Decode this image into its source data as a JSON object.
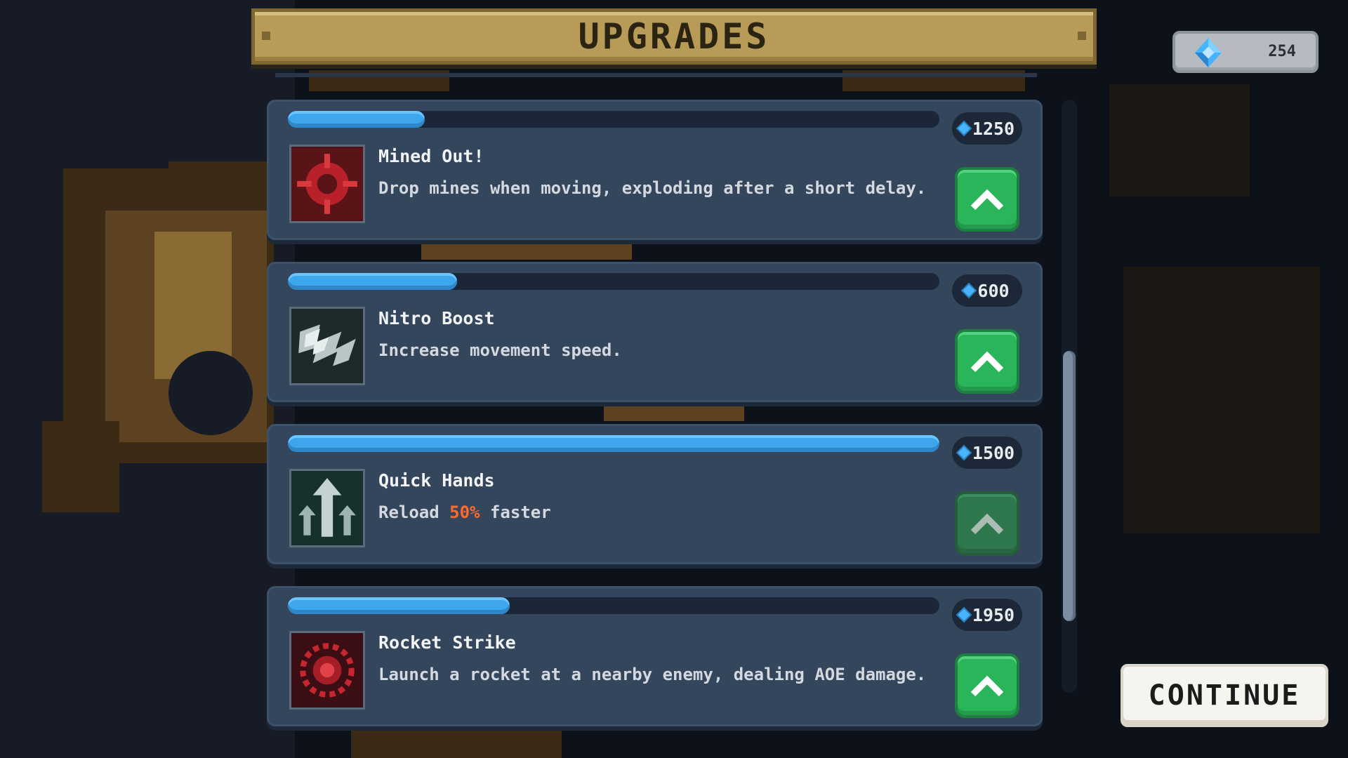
{
  "header": {
    "title": "UPGRADES"
  },
  "currency": {
    "gems": "254",
    "icon": "diamond-gem-icon",
    "color": "#48b4ff"
  },
  "upgrades": [
    {
      "name": "Mined Out!",
      "description": "Drop mines when moving, exploding after a short delay.",
      "cost": "1250",
      "progress": 0.21,
      "icon": "mine-icon",
      "can_afford": true
    },
    {
      "name": "Nitro Boost",
      "description": "Increase movement speed.",
      "cost": "600",
      "progress": 0.26,
      "icon": "lightning-icon",
      "can_afford": true
    },
    {
      "name": "Quick Hands",
      "description_before": "Reload ",
      "description_highlight": "50%",
      "description_after": " faster",
      "cost": "1500",
      "progress": 1.0,
      "icon": "arrows-up-icon",
      "can_afford": false
    },
    {
      "name": "Rocket Strike",
      "description": "Launch a rocket at a nearby enemy, dealing AOE damage.",
      "cost": "1950",
      "progress": 0.34,
      "icon": "target-icon",
      "can_afford": true
    }
  ],
  "actions": {
    "continue_label": "CONTINUE"
  },
  "colors": {
    "progress": "#3ea6ec",
    "upgrade_button": "#2bb55b",
    "highlight": "#ff6a2c",
    "banner": "#b99b58"
  }
}
